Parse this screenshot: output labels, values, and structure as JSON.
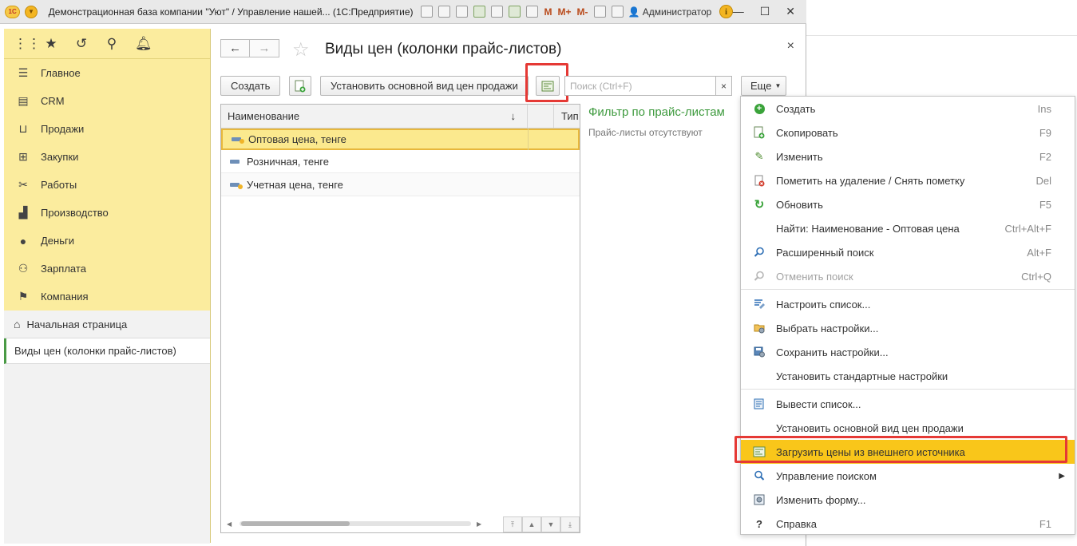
{
  "titlebar": {
    "logo": "1С",
    "title": "Демонстрационная база компании \"Уют\" / Управление нашей... (1С:Предприятие)",
    "memory_buttons": [
      "M",
      "M+",
      "M-"
    ],
    "user": "Администратор",
    "info_icon": "i"
  },
  "sidebar": {
    "top_icons": [
      "apps-grid-icon",
      "star-icon",
      "history-icon",
      "search-icon",
      "bell-icon"
    ],
    "items": [
      {
        "label": "Главное",
        "icon": "menu-lines-icon"
      },
      {
        "label": "CRM",
        "icon": "crm-card-icon"
      },
      {
        "label": "Продажи",
        "icon": "basket-icon"
      },
      {
        "label": "Закупки",
        "icon": "cart-icon"
      },
      {
        "label": "Работы",
        "icon": "tools-icon"
      },
      {
        "label": "Производство",
        "icon": "factory-icon"
      },
      {
        "label": "Деньги",
        "icon": "money-coin-icon"
      },
      {
        "label": "Зарплата",
        "icon": "people-icon"
      },
      {
        "label": "Компания",
        "icon": "flag-icon"
      }
    ],
    "home": "Начальная страница",
    "open_form": "Виды цен (колонки прайс-листов)"
  },
  "form": {
    "title": "Виды цен (колонки прайс-листов)",
    "toolbar": {
      "create": "Создать",
      "set_main": "Установить основной вид цен продажи",
      "search_placeholder": "Поиск (Ctrl+F)",
      "search_clear": "×",
      "more": "Еще"
    },
    "grid": {
      "columns": [
        "Наименование",
        "",
        "Тип"
      ],
      "sort_arrow": "↓",
      "rows": [
        {
          "name": "Оптовая цена, тенге",
          "selected": true,
          "marker": true
        },
        {
          "name": "Розничная, тенге",
          "selected": false,
          "marker": false
        },
        {
          "name": "Учетная цена, тенге",
          "selected": false,
          "marker": true
        }
      ]
    },
    "filter": {
      "title": "Фильтр по прайс-листам",
      "empty_text": "Прайс-листы отсутствуют"
    }
  },
  "more_menu": {
    "groups": [
      [
        {
          "label": "Создать",
          "shortcut": "Ins",
          "icon": "plus-circle-icon"
        },
        {
          "label": "Скопировать",
          "shortcut": "F9",
          "icon": "copy-doc-icon"
        },
        {
          "label": "Изменить",
          "shortcut": "F2",
          "icon": "pencil-icon"
        },
        {
          "label": "Пометить на удаление / Снять пометку",
          "shortcut": "Del",
          "icon": "delete-mark-icon"
        },
        {
          "label": "Обновить",
          "shortcut": "F5",
          "icon": "refresh-icon"
        },
        {
          "label": "Найти: Наименование - Оптовая цена",
          "shortcut": "Ctrl+Alt+F",
          "icon": ""
        },
        {
          "label": "Расширенный поиск",
          "shortcut": "Alt+F",
          "icon": "search-icon"
        },
        {
          "label": "Отменить поиск",
          "shortcut": "Ctrl+Q",
          "icon": "cancel-search-icon",
          "disabled": true
        }
      ],
      [
        {
          "label": "Настроить список...",
          "shortcut": "",
          "icon": "list-settings-icon"
        },
        {
          "label": "Выбрать настройки...",
          "shortcut": "",
          "icon": "folder-settings-icon"
        },
        {
          "label": "Сохранить настройки...",
          "shortcut": "",
          "icon": "save-settings-icon"
        },
        {
          "label": "Установить стандартные настройки",
          "shortcut": "",
          "icon": ""
        }
      ],
      [
        {
          "label": "Вывести список...",
          "shortcut": "",
          "icon": "print-list-icon"
        },
        {
          "label": "Установить основной вид цен продажи",
          "shortcut": "",
          "icon": ""
        },
        {
          "label": "Загрузить цены из внешнего источника",
          "shortcut": "",
          "icon": "load-prices-icon",
          "highlighted": true
        },
        {
          "label": "Управление поиском",
          "shortcut": "",
          "icon": "search-manage-icon",
          "submenu": true
        },
        {
          "label": "Изменить форму...",
          "shortcut": "",
          "icon": "form-edit-icon"
        },
        {
          "label": "Справка",
          "shortcut": "F1",
          "icon": "help-icon"
        }
      ]
    ]
  },
  "colors": {
    "sidebar_bg": "#fbec9e",
    "accent_green": "#3e9a3e",
    "highlight_yellow": "#f9c61a",
    "annotation_red": "#e53935"
  }
}
